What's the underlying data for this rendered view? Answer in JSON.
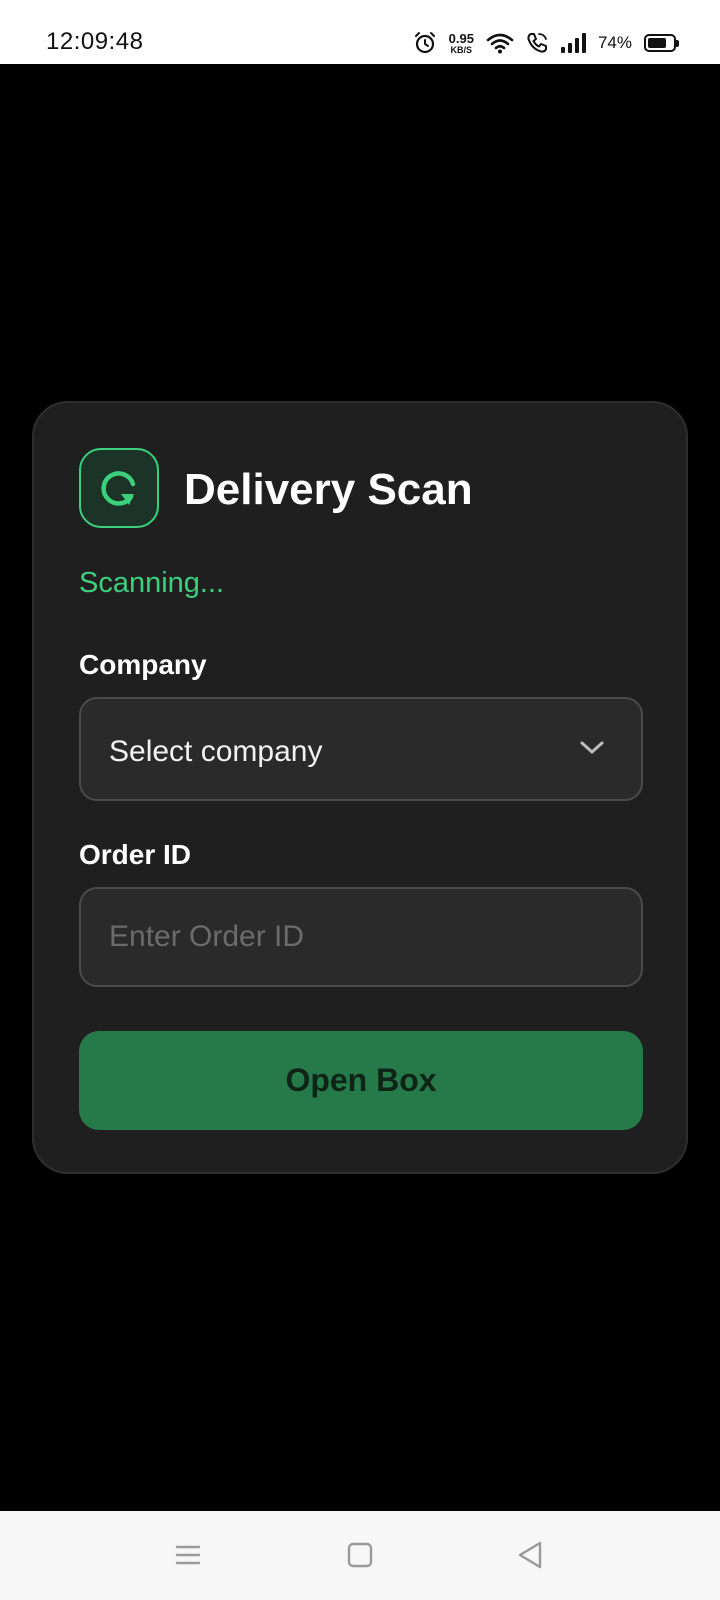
{
  "status_bar": {
    "time": "12:09:48",
    "net_speed_value": "0.95",
    "net_speed_unit": "KB/S",
    "battery_percent": "74%",
    "battery_level": 0.74,
    "icons": [
      "alarm-icon",
      "wifi-icon",
      "wifi-call-icon",
      "signal-icon",
      "battery-icon"
    ]
  },
  "card": {
    "app_icon": "refresh-icon",
    "title": "Delivery Scan",
    "status": "Scanning...",
    "company_label": "Company",
    "company_value": "Select company",
    "order_label": "Order ID",
    "order_placeholder": "Enter Order ID",
    "order_value": "",
    "button_label": "Open Box"
  },
  "colors": {
    "accent": "#3ad07c",
    "button": "#267a4a",
    "card_bg": "#1f1f1f",
    "field_bg": "#2a2a2a"
  },
  "nav_bar": {
    "icons": [
      "menu-icon",
      "home-icon",
      "back-icon"
    ]
  }
}
